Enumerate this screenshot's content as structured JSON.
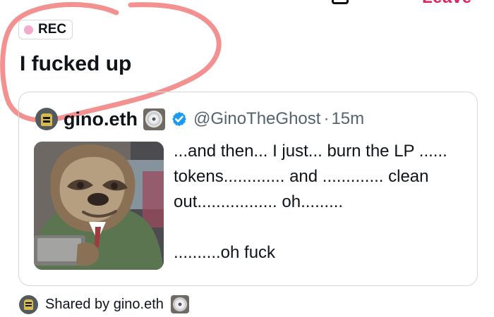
{
  "header": {
    "partial_button_label": "Leave"
  },
  "status": {
    "recording_badge": "REC"
  },
  "post": {
    "title": "I fucked up"
  },
  "quoted_post": {
    "display_name": "gino.eth",
    "handle": "@GinoTheGhost",
    "separator": "·",
    "time": "15m",
    "text": "...and then... I just... burn the LP ......\ntokens............. and ............. clean\nout................. oh.........\n\n..........oh fuck",
    "media_description_icon": "sloth-character-image"
  },
  "footer": {
    "shared_by": "Shared by gino.eth"
  },
  "icons": {
    "recording": "dot-icon",
    "verified": "verified-badge-icon",
    "disc": "disc-icon",
    "avatar": "avatar-icon"
  },
  "colors": {
    "recording_dot": "#f4a9cf",
    "verified_blue": "#1d9bf0",
    "marker_red": "#f28b8b",
    "leave_red": "#e0245e"
  }
}
